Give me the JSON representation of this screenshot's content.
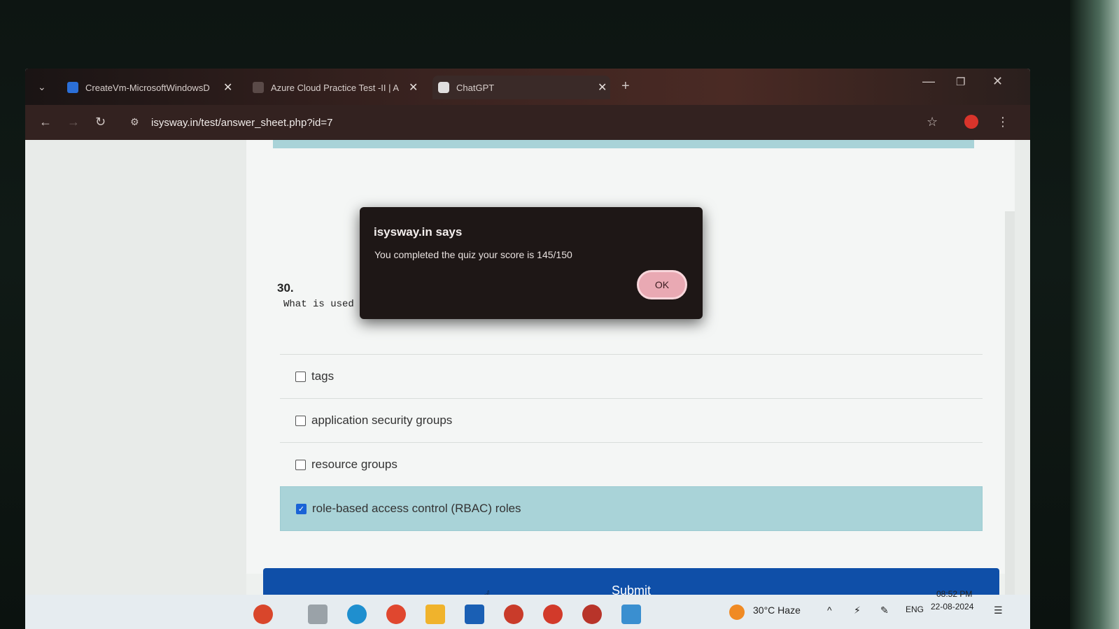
{
  "tabs": [
    {
      "title": "CreateVm-MicrosoftWindowsD",
      "close": "✕"
    },
    {
      "title": "Azure Cloud Practice Test -II | A",
      "close": "✕"
    },
    {
      "title": "ChatGPT",
      "close": "✕"
    }
  ],
  "new_tab_label": "+",
  "url": "isysway.in/test/answer_sheet.php?id=7",
  "window_controls": {
    "minimize": "—",
    "restore": "❐",
    "close": "✕"
  },
  "dialog": {
    "title": "isysway.in says",
    "message": "You completed the quiz your score is 145/150",
    "ok_label": "OK"
  },
  "question": {
    "number": "30.",
    "text_visible": "What is used"
  },
  "options": [
    {
      "label": "tags",
      "checked": false
    },
    {
      "label": "application security groups",
      "checked": false
    },
    {
      "label": "resource groups",
      "checked": false
    },
    {
      "label": "role-based access control (RBAC) roles",
      "checked": true
    }
  ],
  "submit_label": "Submit",
  "taskbar": {
    "weather": "30°C  Haze",
    "lang": "ENG",
    "time": "08:52 PM",
    "date": "22-08-2024"
  },
  "colors": {
    "accent_button": "#0f4fa8",
    "selected_option": "#a9d3d8",
    "dialog_bg": "#1e1716",
    "ok_button": "#e9a9b3"
  }
}
